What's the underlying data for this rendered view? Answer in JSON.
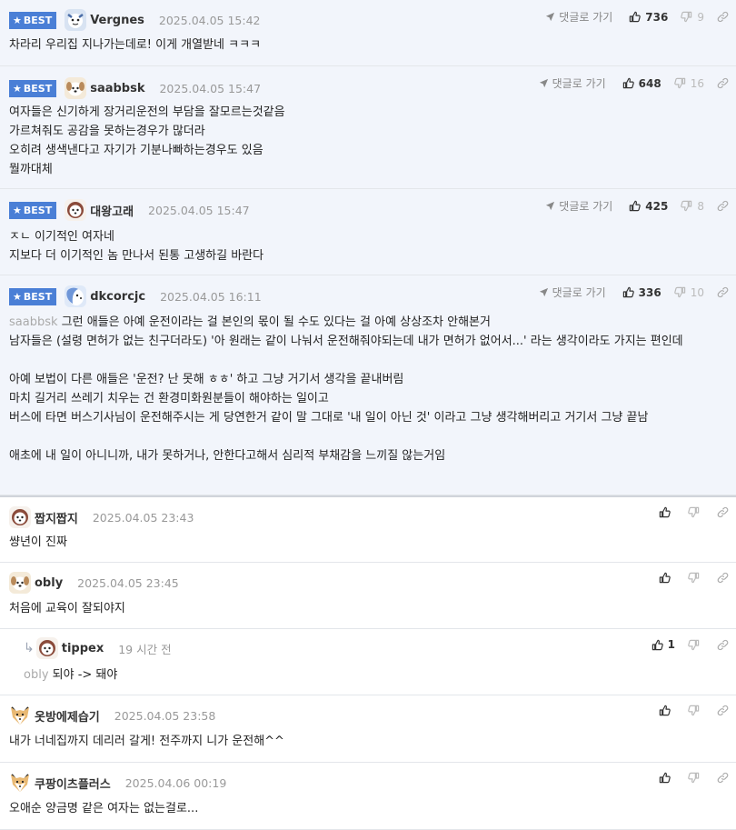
{
  "actions": {
    "reply_label": "댓글로 가기"
  },
  "comments": [
    {
      "author": "Vergnes",
      "date": "2025.04.05 15:42",
      "best": "BEST",
      "up": "736",
      "down": "9",
      "lines": [
        "차라리 우리집 지나가는데로! 이게 개열받네 ㅋㅋㅋ"
      ]
    },
    {
      "author": "saabbsk",
      "date": "2025.04.05 15:47",
      "best": "BEST",
      "up": "648",
      "down": "16",
      "lines": [
        "여자들은 신기하게 장거리운전의 부담을 잘모르는것같음",
        "가르쳐줘도 공감을 못하는경우가 많더라",
        "오히려 생색낸다고 자기가 기분나빠하는경우도 있음",
        "뭘까대체"
      ]
    },
    {
      "author": "대왕고래",
      "date": "2025.04.05 15:47",
      "best": "BEST",
      "up": "425",
      "down": "8",
      "lines": [
        "ㅈㄴ 이기적인 여자네",
        "지보다 더 이기적인 놈 만나서 된통 고생하길 바란다"
      ]
    },
    {
      "author": "dkcorcjc",
      "date": "2025.04.05 16:11",
      "best": "BEST",
      "up": "336",
      "down": "10",
      "mention": "saabbsk",
      "lines": [
        "그런 애들은 아예 운전이라는 걸 본인의 몫이 될 수도 있다는 걸 아예 상상조차 안해본거",
        "남자들은 (설령 면허가 없는 친구더라도) '아 원래는 같이 나눠서 운전해줘야되는데 내가 면허가 없어서...' 라는 생각이라도 가지는 편인데",
        "",
        "아예 보법이 다른 애들은 '운전? 난 못해 ㅎㅎ' 하고 그냥 거기서 생각을 끝내버림",
        "마치 길거리 쓰레기 치우는 건 환경미화원분들이 해야하는 일이고",
        "버스에 타면 버스기사님이 운전해주시는 게 당연한거 같이 말 그대로 '내 일이 아닌 것' 이라고 그냥 생각해버리고 거기서 그냥 끝남",
        "",
        "애초에 내 일이 아니니까, 내가 못하거나, 안한다고해서 심리적 부채감을 느끼질 않는거임"
      ]
    },
    {
      "author": "짭지짭지",
      "date": "2025.04.05 23:43",
      "up": "",
      "lines": [
        "썅년이 진짜"
      ]
    },
    {
      "author": "obly",
      "date": "2025.04.05 23:45",
      "up": "",
      "lines": [
        "처음에 교육이 잘되야지"
      ]
    },
    {
      "author": "tippex",
      "date": "19 시간 전",
      "up": "1",
      "mention": "obly",
      "lines": [
        "되야 -> 돼야"
      ]
    },
    {
      "author": "옷방에제습기",
      "date": "2025.04.05 23:58",
      "up": "",
      "lines": [
        "내가 너네집까지 데리러 갈게! 전주까지 니가 운전해^^"
      ]
    },
    {
      "author": "쿠팡이츠플러스",
      "date": "2025.04.06 00:19",
      "up": "",
      "lines": [
        "오애순 양금명 같은 여자는 없는걸로..."
      ]
    }
  ]
}
